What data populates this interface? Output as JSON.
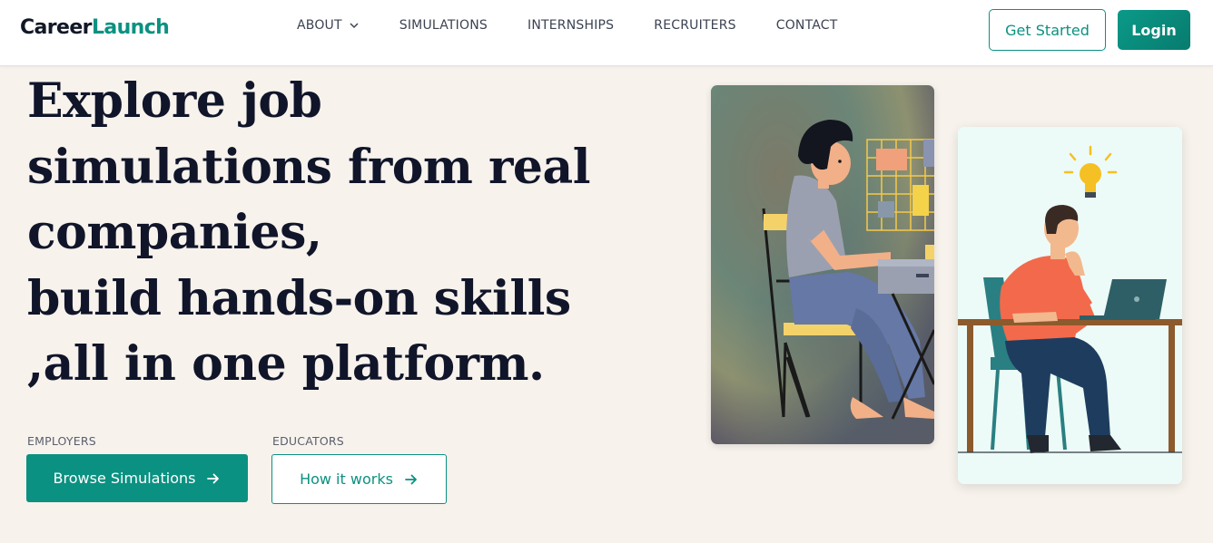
{
  "brand": {
    "part1": "Career",
    "part2": "Launch"
  },
  "nav": {
    "about": "ABOUT",
    "simulations": "SIMULATIONS",
    "internships": "INTERNSHIPS",
    "recruiters": "RECRUITERS",
    "contact": "CONTACT"
  },
  "header_buttons": {
    "get_started": "Get Started",
    "login": "Login"
  },
  "hero": {
    "headline_lines": [
      "Explore job",
      "simulations from real",
      "companies,",
      "build hands-on skills",
      ",all in one platform."
    ],
    "employers_label": "EMPLOYERS",
    "educators_label": "EDUCATORS",
    "browse_button": "Browse Simulations",
    "how_button": "How it works"
  },
  "icons": {
    "about_dropdown": "chevron-down-icon",
    "browse_arrow": "arrow-right-icon",
    "how_arrow": "arrow-right-icon",
    "idea": "lightbulb-icon"
  },
  "colors": {
    "brand_teal": "#0b9181",
    "background": "#f7f2ec",
    "headline": "#10152a",
    "card_mint": "#ecfbf7"
  }
}
